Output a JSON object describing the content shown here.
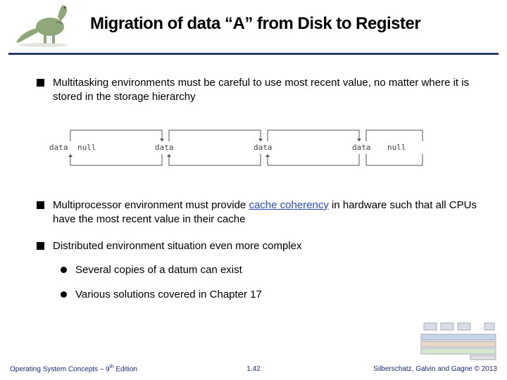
{
  "header": {
    "title": "Migration of data “A” from Disk to Register"
  },
  "bullets": {
    "b1": "Multitasking environments must be careful to use most recent value, no matter where it is stored in the storage hierarchy",
    "b2_pre": "Multiprocessor environment must provide ",
    "b2_link": "cache coherency",
    "b2_post": " in hardware such that all CPUs have the most recent value in their cache",
    "b3": "Distributed environment situation even more complex",
    "b3_s1": "Several copies of a datum can exist",
    "b3_s2": "Various solutions covered in Chapter 17"
  },
  "diagram": {
    "labels": [
      "data",
      "null",
      "data",
      "data",
      "data",
      "null"
    ]
  },
  "footer": {
    "left_pre": "Operating System Concepts – 9",
    "left_sup": "th",
    "left_post": " Edition",
    "center": "1.42",
    "right": "Silberschatz, Galvin and Gagne © 2013"
  }
}
